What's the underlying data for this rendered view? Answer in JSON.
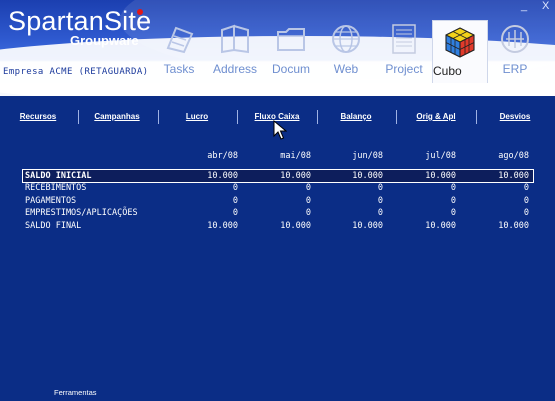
{
  "header": {
    "brand": "SpartanSite",
    "brand_sub": "Groupware",
    "company": "Empresa ACME (RETAGUARDA)",
    "window_min": "_",
    "window_close": "X"
  },
  "nav": [
    {
      "label": "Tasks",
      "icon": "tasks-icon"
    },
    {
      "label": "Address",
      "icon": "address-book-icon"
    },
    {
      "label": "Docum",
      "icon": "documents-icon"
    },
    {
      "label": "Web",
      "icon": "globe-icon"
    },
    {
      "label": "Project",
      "icon": "project-icon"
    },
    {
      "label": "Cubo",
      "icon": "cube-icon",
      "active": true
    },
    {
      "label": "ERP",
      "icon": "erp-icon"
    }
  ],
  "tabs": [
    "Recursos",
    "Campanhas",
    "Lucro",
    "Fluxo Caixa",
    "Balanço",
    "Orig & Apl",
    "Desvios"
  ],
  "table": {
    "columns": [
      "abr/08",
      "mai/08",
      "jun/08",
      "jul/08",
      "ago/08"
    ],
    "rows": [
      {
        "label": "SALDO INICIAL",
        "values": [
          "10.000",
          "10.000",
          "10.000",
          "10.000",
          "10.000"
        ]
      },
      {
        "label": "RECEBIMENTOS",
        "values": [
          "0",
          "0",
          "0",
          "0",
          "0"
        ]
      },
      {
        "label": "PAGAMENTOS",
        "values": [
          "0",
          "0",
          "0",
          "0",
          "0"
        ]
      },
      {
        "label": "EMPRESTIMOS/APLICAÇÕES",
        "values": [
          "0",
          "0",
          "0",
          "0",
          "0"
        ]
      },
      {
        "label": "SALDO FINAL",
        "values": [
          "10.000",
          "10.000",
          "10.000",
          "10.000",
          "10.000"
        ]
      }
    ]
  },
  "footer": "Ferramentas",
  "colors": {
    "background": "#0b2d86",
    "selected_row": "#0d1e5c",
    "accent": "#e01818"
  }
}
